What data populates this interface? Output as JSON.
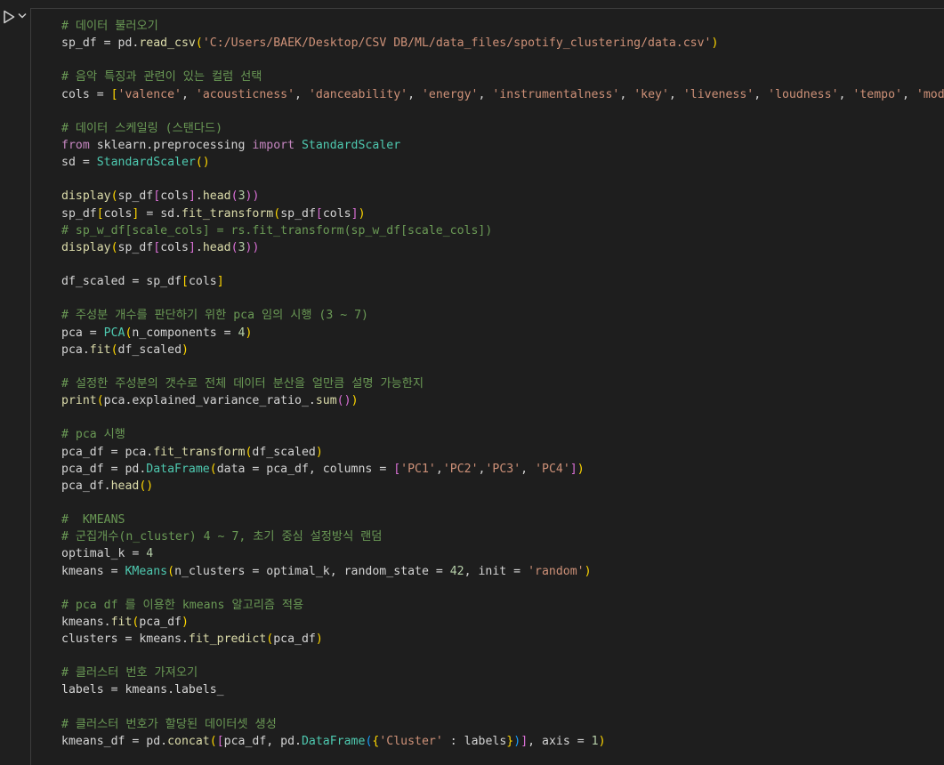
{
  "colors": {
    "background": "#1e1e1e",
    "keyword": "#c586c0",
    "function": "#dcdcaa",
    "class": "#4ec9b0",
    "string": "#ce9178",
    "number": "#b5cea8",
    "comment": "#6a9955",
    "text": "#d4d4d4"
  },
  "toolbar": {
    "run_icon": "run-cell-icon",
    "collapse_icon": "chevron-down-icon"
  },
  "lines": [
    [
      [
        "cm",
        "# 데이터 불러오기"
      ]
    ],
    [
      [
        "p",
        "sp_df = "
      ],
      [
        "p",
        "pd."
      ],
      [
        "fn",
        "read_csv"
      ],
      [
        "br1",
        "("
      ],
      [
        "str",
        "'C:/Users/BAEK/Desktop/CSV DB/ML/data_files/spotify_clustering/data.csv'"
      ],
      [
        "br1",
        ")"
      ]
    ],
    [],
    [
      [
        "cm",
        "# 음악 특징과 관련이 있는 컬럼 선택"
      ]
    ],
    [
      [
        "p",
        "cols = "
      ],
      [
        "br1",
        "["
      ],
      [
        "str",
        "'valence'"
      ],
      [
        "p",
        ", "
      ],
      [
        "str",
        "'acousticness'"
      ],
      [
        "p",
        ", "
      ],
      [
        "str",
        "'danceability'"
      ],
      [
        "p",
        ", "
      ],
      [
        "str",
        "'energy'"
      ],
      [
        "p",
        ", "
      ],
      [
        "str",
        "'instrumentalness'"
      ],
      [
        "p",
        ", "
      ],
      [
        "str",
        "'key'"
      ],
      [
        "p",
        ", "
      ],
      [
        "str",
        "'liveness'"
      ],
      [
        "p",
        ", "
      ],
      [
        "str",
        "'loudness'"
      ],
      [
        "p",
        ", "
      ],
      [
        "str",
        "'tempo'"
      ],
      [
        "p",
        ", "
      ],
      [
        "str",
        "'mode'"
      ],
      [
        "br1",
        "]"
      ]
    ],
    [],
    [
      [
        "cm",
        "# 데이터 스케일링 (스탠다드)"
      ]
    ],
    [
      [
        "kw",
        "from"
      ],
      [
        "p",
        " sklearn.preprocessing "
      ],
      [
        "kw",
        "import"
      ],
      [
        "p",
        " "
      ],
      [
        "cls",
        "StandardScaler"
      ]
    ],
    [
      [
        "p",
        "sd = "
      ],
      [
        "cls",
        "StandardScaler"
      ],
      [
        "br1",
        "()"
      ]
    ],
    [],
    [
      [
        "fn",
        "display"
      ],
      [
        "br1",
        "("
      ],
      [
        "p",
        "sp_df"
      ],
      [
        "br2",
        "["
      ],
      [
        "p",
        "cols"
      ],
      [
        "br2",
        "]"
      ],
      [
        "p",
        "."
      ],
      [
        "fn",
        "head"
      ],
      [
        "br2",
        "("
      ],
      [
        "num",
        "3"
      ],
      [
        "br2",
        "))"
      ]
    ],
    [
      [
        "p",
        "sp_df"
      ],
      [
        "br1",
        "["
      ],
      [
        "p",
        "cols"
      ],
      [
        "br1",
        "]"
      ],
      [
        "p",
        " = sd."
      ],
      [
        "fn",
        "fit_transform"
      ],
      [
        "br1",
        "("
      ],
      [
        "p",
        "sp_df"
      ],
      [
        "br2",
        "["
      ],
      [
        "p",
        "cols"
      ],
      [
        "br2",
        "]"
      ],
      [
        "br1",
        ")"
      ]
    ],
    [
      [
        "cm",
        "# sp_w_df[scale_cols] = rs.fit_transform(sp_w_df[scale_cols])"
      ]
    ],
    [
      [
        "fn",
        "display"
      ],
      [
        "br1",
        "("
      ],
      [
        "p",
        "sp_df"
      ],
      [
        "br2",
        "["
      ],
      [
        "p",
        "cols"
      ],
      [
        "br2",
        "]"
      ],
      [
        "p",
        "."
      ],
      [
        "fn",
        "head"
      ],
      [
        "br2",
        "("
      ],
      [
        "num",
        "3"
      ],
      [
        "br2",
        "))"
      ]
    ],
    [],
    [
      [
        "p",
        "df_scaled = sp_df"
      ],
      [
        "br1",
        "["
      ],
      [
        "p",
        "cols"
      ],
      [
        "br1",
        "]"
      ]
    ],
    [],
    [
      [
        "cm",
        "# 주성분 개수를 판단하기 위한 pca 임의 시행 (3 ~ 7)"
      ]
    ],
    [
      [
        "p",
        "pca = "
      ],
      [
        "cls",
        "PCA"
      ],
      [
        "br1",
        "("
      ],
      [
        "p",
        "n_components = "
      ],
      [
        "num",
        "4"
      ],
      [
        "br1",
        ")"
      ]
    ],
    [
      [
        "p",
        "pca."
      ],
      [
        "fn",
        "fit"
      ],
      [
        "br1",
        "("
      ],
      [
        "p",
        "df_scaled"
      ],
      [
        "br1",
        ")"
      ]
    ],
    [],
    [
      [
        "cm",
        "# 설정한 주성분의 갯수로 전체 데이터 분산을 얼만큼 설명 가능한지"
      ]
    ],
    [
      [
        "fn",
        "print"
      ],
      [
        "br1",
        "("
      ],
      [
        "p",
        "pca.explained_variance_ratio_."
      ],
      [
        "fn",
        "sum"
      ],
      [
        "br2",
        "()"
      ],
      [
        "br1",
        ")"
      ]
    ],
    [],
    [
      [
        "cm",
        "# pca 시행"
      ]
    ],
    [
      [
        "p",
        "pca_df = pca."
      ],
      [
        "fn",
        "fit_transform"
      ],
      [
        "br1",
        "("
      ],
      [
        "p",
        "df_scaled"
      ],
      [
        "br1",
        ")"
      ]
    ],
    [
      [
        "p",
        "pca_df = pd."
      ],
      [
        "cls",
        "DataFrame"
      ],
      [
        "br1",
        "("
      ],
      [
        "p",
        "data = pca_df, columns = "
      ],
      [
        "br2",
        "["
      ],
      [
        "str",
        "'PC1'"
      ],
      [
        "p",
        ","
      ],
      [
        "str",
        "'PC2'"
      ],
      [
        "p",
        ","
      ],
      [
        "str",
        "'PC3'"
      ],
      [
        "p",
        ", "
      ],
      [
        "str",
        "'PC4'"
      ],
      [
        "br2",
        "]"
      ],
      [
        "br1",
        ")"
      ]
    ],
    [
      [
        "p",
        "pca_df."
      ],
      [
        "fn",
        "head"
      ],
      [
        "br1",
        "()"
      ]
    ],
    [],
    [
      [
        "cm",
        "#  KMEANS"
      ]
    ],
    [
      [
        "cm",
        "# 군집개수(n_cluster) 4 ~ 7, 초기 중심 설정방식 랜덤"
      ]
    ],
    [
      [
        "p",
        "optimal_k = "
      ],
      [
        "num",
        "4"
      ]
    ],
    [
      [
        "p",
        "kmeans = "
      ],
      [
        "cls",
        "KMeans"
      ],
      [
        "br1",
        "("
      ],
      [
        "p",
        "n_clusters = optimal_k, random_state = "
      ],
      [
        "num",
        "42"
      ],
      [
        "p",
        ", init = "
      ],
      [
        "str",
        "'random'"
      ],
      [
        "br1",
        ")"
      ]
    ],
    [],
    [
      [
        "cm",
        "# pca df 를 이용한 kmeans 알고리즘 적용"
      ]
    ],
    [
      [
        "p",
        "kmeans."
      ],
      [
        "fn",
        "fit"
      ],
      [
        "br1",
        "("
      ],
      [
        "p",
        "pca_df"
      ],
      [
        "br1",
        ")"
      ]
    ],
    [
      [
        "p",
        "clusters = kmeans."
      ],
      [
        "fn",
        "fit_predict"
      ],
      [
        "br1",
        "("
      ],
      [
        "p",
        "pca_df"
      ],
      [
        "br1",
        ")"
      ]
    ],
    [],
    [
      [
        "cm",
        "# 클러스터 번호 가져오기"
      ]
    ],
    [
      [
        "p",
        "labels = kmeans.labels_"
      ]
    ],
    [],
    [
      [
        "cm",
        "# 클러스터 번호가 할당된 데이터셋 생성"
      ]
    ],
    [
      [
        "p",
        "kmeans_df = pd."
      ],
      [
        "fn",
        "concat"
      ],
      [
        "br1",
        "("
      ],
      [
        "br2",
        "["
      ],
      [
        "p",
        "pca_df, pd."
      ],
      [
        "cls",
        "DataFrame"
      ],
      [
        "br3",
        "("
      ],
      [
        "br1",
        "{"
      ],
      [
        "str",
        "'Cluster'"
      ],
      [
        "p",
        " : labels"
      ],
      [
        "br1",
        "}"
      ],
      [
        "br3",
        ")"
      ],
      [
        "br2",
        "]"
      ],
      [
        "p",
        ", axis = "
      ],
      [
        "num",
        "1"
      ],
      [
        "br1",
        ")"
      ]
    ]
  ]
}
